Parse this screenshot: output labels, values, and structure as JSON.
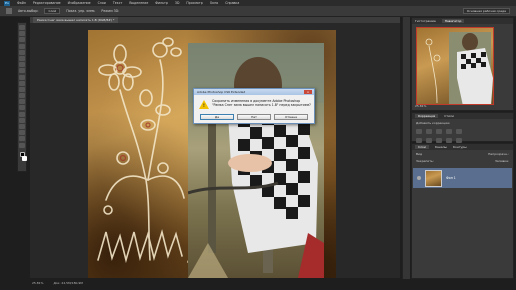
{
  "menubar": {
    "logo": "Ps",
    "items": [
      "Файл",
      "Редактирование",
      "Изображение",
      "Слои",
      "Текст",
      "Выделение",
      "Фильтр",
      "3D",
      "Просмотр",
      "Окно",
      "Справка"
    ]
  },
  "options": {
    "items": [
      "Авто-выбор:",
      "Слой",
      "Показ. упр. элем."
    ],
    "mode_3d": "Режим 3D:",
    "workspace": "Основная рабочая среда"
  },
  "document": {
    "tab_title": "Рамка Снег зима вышел написать 1.В (RGB/8#) *",
    "zoom": "25.81%",
    "doc_info": "Док: 22,5M/180,9M"
  },
  "dialog": {
    "title": "Adobe Photoshop CS6 Extended",
    "close_label": "x",
    "message": "Сохранить изменения в документе Adobe Photoshop \"Рамка Снег зима вышел написать 1.В\" перед закрытием?",
    "buttons": [
      "Да",
      "Нет",
      "Отмена"
    ]
  },
  "panels": {
    "navigator": {
      "tabs": [
        "Гистограмма",
        "Навигатор"
      ],
      "zoom": "25.81%"
    },
    "adjustments": {
      "tabs": [
        "Коррекция",
        "Стили"
      ],
      "label": "Добавить коррекцию"
    },
    "layers": {
      "tabs": [
        "Слои",
        "Каналы",
        "Контуры"
      ],
      "kind_label": "Вид",
      "opacity_label": "Непрозрачн.:",
      "lock_label": "Закрепить:",
      "fill_label": "Заливка:",
      "layer_name": "Фон 1"
    }
  },
  "colors": {
    "accent": "#5a6f8f",
    "warn": "#f2c200",
    "nav_frame": "#c23a2a"
  }
}
